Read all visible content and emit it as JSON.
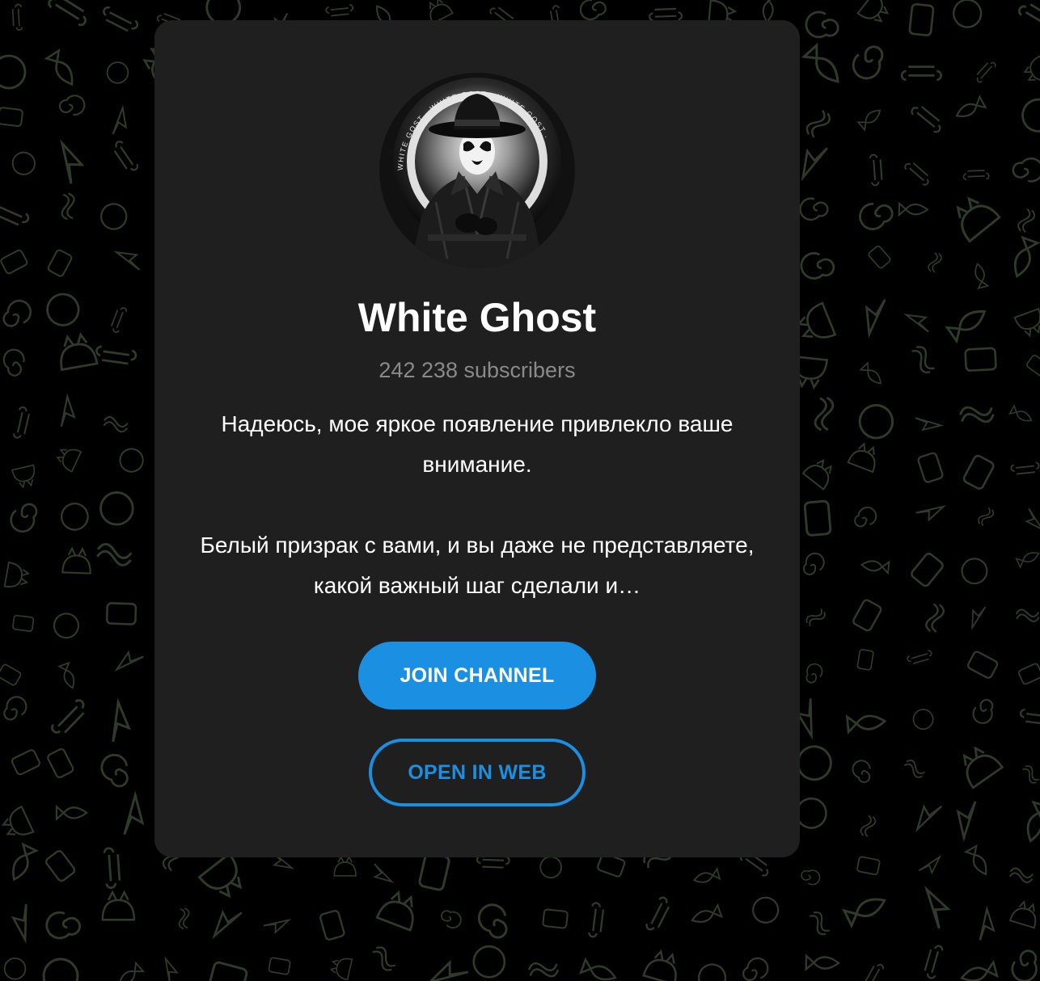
{
  "channel": {
    "title": "White Ghost",
    "subscribers": "242 238 subscribers",
    "description_p1": "Надеюсь, мое яркое появление привлекло ваше внимание.",
    "description_p2": "Белый призрак с вами, и вы даже не представляете, какой важный шаг сделали и…",
    "avatar_ring_text": "WHITE GOST · WHITE GOST · WHITE GOST ·"
  },
  "actions": {
    "join_label": "JOIN CHANNEL",
    "web_label": "OPEN IN WEB"
  },
  "colors": {
    "background": "#000000",
    "card": "#1f1f1f",
    "accent": "#1b8fe2",
    "doodle": "#2f3a2a",
    "muted_text": "#8a8a8a"
  }
}
